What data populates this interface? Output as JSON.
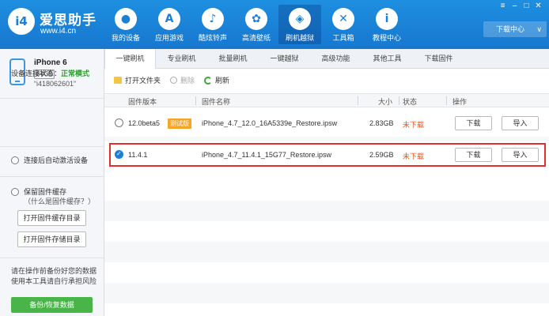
{
  "app": {
    "logo_text": "i4",
    "brand_name": "爱思助手",
    "brand_url": "www.i4.cn",
    "accent": "#1b7fd8"
  },
  "window_controls": [
    "≡",
    "–",
    "□",
    "✕"
  ],
  "download_center": {
    "label": "下载中心",
    "chevron": "∨"
  },
  "nav": [
    {
      "label": "我的设备",
      "icon": "apple-icon",
      "glyph": ""
    },
    {
      "label": "应用游戏",
      "icon": "app-store-icon",
      "glyph": "A"
    },
    {
      "label": "酷炫铃声",
      "icon": "bell-icon",
      "glyph": "♪"
    },
    {
      "label": "高清壁纸",
      "icon": "flower-icon",
      "glyph": "✿"
    },
    {
      "label": "刷机越狱",
      "icon": "dropbox-icon",
      "glyph": "◈"
    },
    {
      "label": "工具箱",
      "icon": "toolbox-icon",
      "glyph": "✕"
    },
    {
      "label": "教程中心",
      "icon": "info-icon",
      "glyph": "i"
    }
  ],
  "device": {
    "name": "iPhone 6",
    "capacity": "64GB",
    "id": "“i418062601”"
  },
  "sidebar": {
    "conn_label": "设备连接状态：",
    "conn_value": "正常模式",
    "auto_activate": "连接后自动激活设备",
    "keep_cache": "保留固件缓存",
    "keep_cache_hint": "（什么是固件缓存？）",
    "open_cache_dir": "打开固件缓存目录",
    "open_storage_dir": "打开固件存储目录",
    "warning": "请在操作前备份好您的数据使用本工具请自行承担风险",
    "backup_button": "备份/恢复数据"
  },
  "tabs": [
    "一键刷机",
    "专业刷机",
    "批量刷机",
    "一键越狱",
    "高级功能",
    "其他工具",
    "下载固件"
  ],
  "toolbar": {
    "open_folder": "打开文件夹",
    "delete": "删除",
    "refresh": "刷新"
  },
  "table": {
    "headers": {
      "version": "固件版本",
      "name": "固件名称",
      "size": "大小",
      "status": "状态",
      "action": "操作"
    },
    "rows": [
      {
        "version": "12.0beta5",
        "badge": "测试版",
        "name": "iPhone_4.7_12.0_16A5339e_Restore.ipsw",
        "size": "2.83GB",
        "status": "未下载",
        "download": "下载",
        "import": "导入",
        "selected": false
      },
      {
        "version": "11.4.1",
        "badge": "",
        "name": "iPhone_4.7_11.4.1_15G77_Restore.ipsw",
        "size": "2.59GB",
        "status": "未下载",
        "download": "下载",
        "import": "导入",
        "selected": true
      }
    ]
  }
}
